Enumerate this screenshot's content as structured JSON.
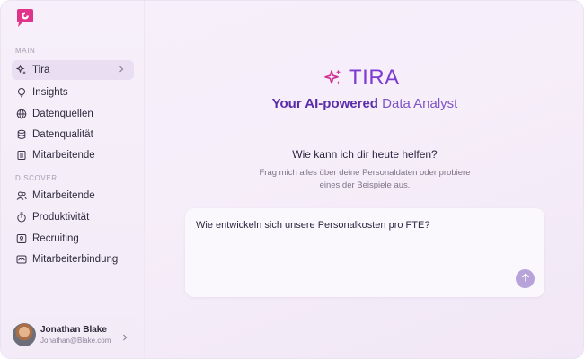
{
  "app": {
    "accent_color": "#7d3bd1",
    "brand_icon": "sparkles-icon"
  },
  "sidebar": {
    "logo_icon": "chat-bubble-logo-icon",
    "sections": [
      {
        "label": "MAIN",
        "items": [
          {
            "label": "Tira",
            "icon": "sparkles-icon",
            "active": true,
            "has_chevron": true
          },
          {
            "label": "Insights",
            "icon": "lightbulb-icon"
          },
          {
            "label": "Datenquellen",
            "icon": "globe-icon"
          },
          {
            "label": "Datenqualität",
            "icon": "database-icon"
          },
          {
            "label": "Mitarbeitende",
            "icon": "list-icon"
          }
        ]
      },
      {
        "label": "DISCOVER",
        "items": [
          {
            "label": "Mitarbeitende",
            "icon": "people-icon"
          },
          {
            "label": "Produktivität",
            "icon": "stopwatch-icon"
          },
          {
            "label": "Recruiting",
            "icon": "id-card-icon"
          },
          {
            "label": "Mitarbeiterbindung",
            "icon": "handshake-icon"
          }
        ]
      }
    ],
    "user": {
      "name": "Jonathan Blake",
      "email": "Jonathan@Blake.com"
    }
  },
  "main": {
    "brand_title": "TIRA",
    "subtitle_bold": "Your AI-powered ",
    "subtitle_light": "Data Analyst",
    "help_title": "Wie kann ich dir heute helfen?",
    "help_desc": "Frag mich alles über deine Personaldaten oder probiere eines der Beispiele aus.",
    "prompt": {
      "value": "Wie entwickeln sich unsere Personalkosten pro FTE?"
    },
    "send_icon": "arrow-up-icon"
  }
}
